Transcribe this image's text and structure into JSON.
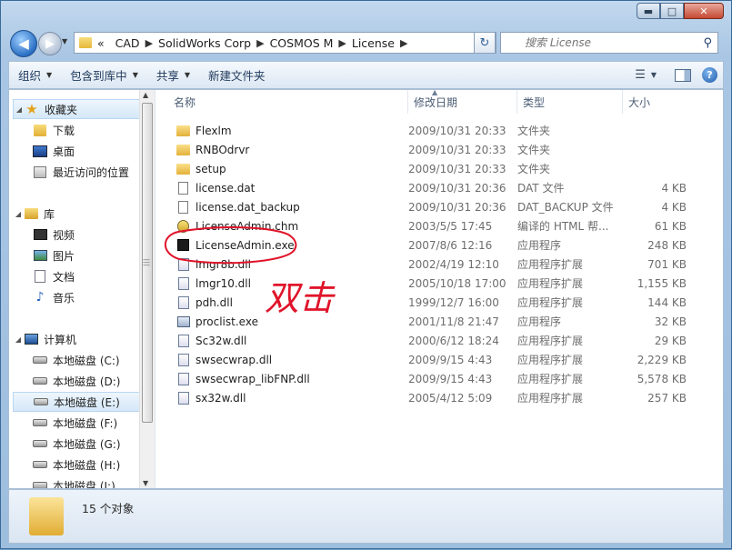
{
  "window": {
    "min_symbol": "▬",
    "max_symbol": "□",
    "close_symbol": "✕"
  },
  "nav": {
    "back_symbol": "◀",
    "forward_symbol": "▶",
    "refresh_symbol": "↻"
  },
  "address": {
    "overflow": "«",
    "crumbs": [
      "CAD",
      "SolidWorks Corp",
      "COSMOS M",
      "License"
    ]
  },
  "search": {
    "placeholder": "搜索 License"
  },
  "toolbar": {
    "organize": "组织",
    "include_in_library": "包含到库中",
    "share": "共享",
    "new_folder": "新建文件夹"
  },
  "sidebar": {
    "favorites": "收藏夹",
    "downloads": "下载",
    "desktop": "桌面",
    "recent": "最近访问的位置",
    "libraries": "库",
    "videos": "视频",
    "pictures": "图片",
    "documents": "文档",
    "music": "音乐",
    "computer": "计算机",
    "drives": [
      "本地磁盘 (C:)",
      "本地磁盘 (D:)",
      "本地磁盘 (E:)",
      "本地磁盘 (F:)",
      "本地磁盘 (G:)",
      "本地磁盘 (H:)",
      "本地磁盘 (I:)"
    ]
  },
  "columns": {
    "name": "名称",
    "date": "修改日期",
    "type": "类型",
    "size": "大小"
  },
  "files": [
    {
      "name": "Flexlm",
      "date": "2009/10/31 20:33",
      "type": "文件夹",
      "size": "",
      "icon": "folder-icon"
    },
    {
      "name": "RNBOdrvr",
      "date": "2009/10/31 20:33",
      "type": "文件夹",
      "size": "",
      "icon": "folder-icon"
    },
    {
      "name": "setup",
      "date": "2009/10/31 20:33",
      "type": "文件夹",
      "size": "",
      "icon": "folder-icon"
    },
    {
      "name": "license.dat",
      "date": "2009/10/31 20:36",
      "type": "DAT 文件",
      "size": "4 KB",
      "icon": "file-icon"
    },
    {
      "name": "license.dat_backup",
      "date": "2009/10/31 20:36",
      "type": "DAT_BACKUP 文件",
      "size": "4 KB",
      "icon": "file-icon"
    },
    {
      "name": "LicenseAdmin.chm",
      "date": "2003/5/5 17:45",
      "type": "编译的 HTML 帮...",
      "size": "61 KB",
      "icon": "help-file-icon"
    },
    {
      "name": "LicenseAdmin.exe",
      "date": "2007/8/6 12:16",
      "type": "应用程序",
      "size": "248 KB",
      "icon": "exe-icon"
    },
    {
      "name": "lmgr8b.dll",
      "date": "2002/4/19 12:10",
      "type": "应用程序扩展",
      "size": "701 KB",
      "icon": "dll-icon"
    },
    {
      "name": "lmgr10.dll",
      "date": "2005/10/18 17:00",
      "type": "应用程序扩展",
      "size": "1,155 KB",
      "icon": "dll-icon"
    },
    {
      "name": "pdh.dll",
      "date": "1999/12/7 16:00",
      "type": "应用程序扩展",
      "size": "144 KB",
      "icon": "dll-icon"
    },
    {
      "name": "proclist.exe",
      "date": "2001/11/8 21:47",
      "type": "应用程序",
      "size": "32 KB",
      "icon": "app-icon"
    },
    {
      "name": "Sc32w.dll",
      "date": "2000/6/12 18:24",
      "type": "应用程序扩展",
      "size": "29 KB",
      "icon": "dll-icon"
    },
    {
      "name": "swsecwrap.dll",
      "date": "2009/9/15 4:43",
      "type": "应用程序扩展",
      "size": "2,229 KB",
      "icon": "dll-icon"
    },
    {
      "name": "swsecwrap_libFNP.dll",
      "date": "2009/9/15 4:43",
      "type": "应用程序扩展",
      "size": "5,578 KB",
      "icon": "dll-icon"
    },
    {
      "name": "sx32w.dll",
      "date": "2005/4/12 5:09",
      "type": "应用程序扩展",
      "size": "257 KB",
      "icon": "dll-icon"
    }
  ],
  "status": {
    "count": "15 个对象"
  },
  "annotation": {
    "text": "双击",
    "color": "#e0142a"
  }
}
